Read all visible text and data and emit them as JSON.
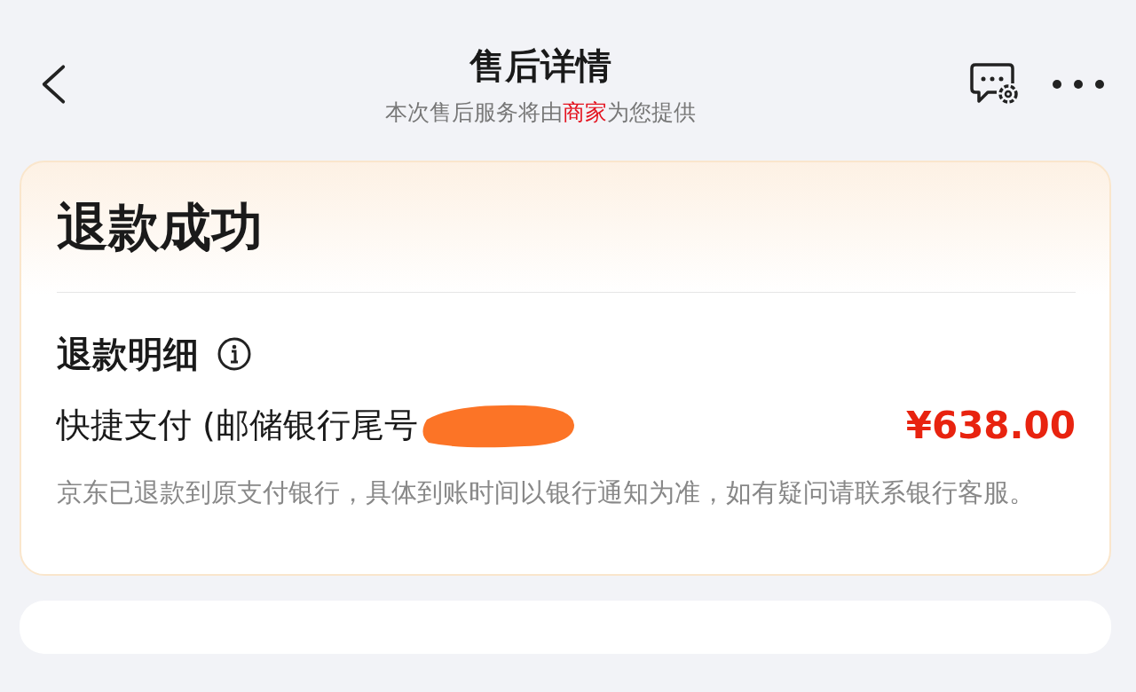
{
  "header": {
    "title": "售后详情",
    "subtitle": [
      {
        "text": "本次售后服务将由",
        "highlight": false
      },
      {
        "text": "商家",
        "highlight": true
      },
      {
        "text": "为您提供",
        "highlight": false
      }
    ]
  },
  "status": {
    "title": "退款成功"
  },
  "refund": {
    "heading": "退款明细",
    "method": "快捷支付 (邮储银行尾号",
    "redacted": true,
    "amount": "¥638.00",
    "note": "京东已退款到原支付银行，具体到账时间以银行通知为准，如有疑问请联系银行客服。"
  }
}
